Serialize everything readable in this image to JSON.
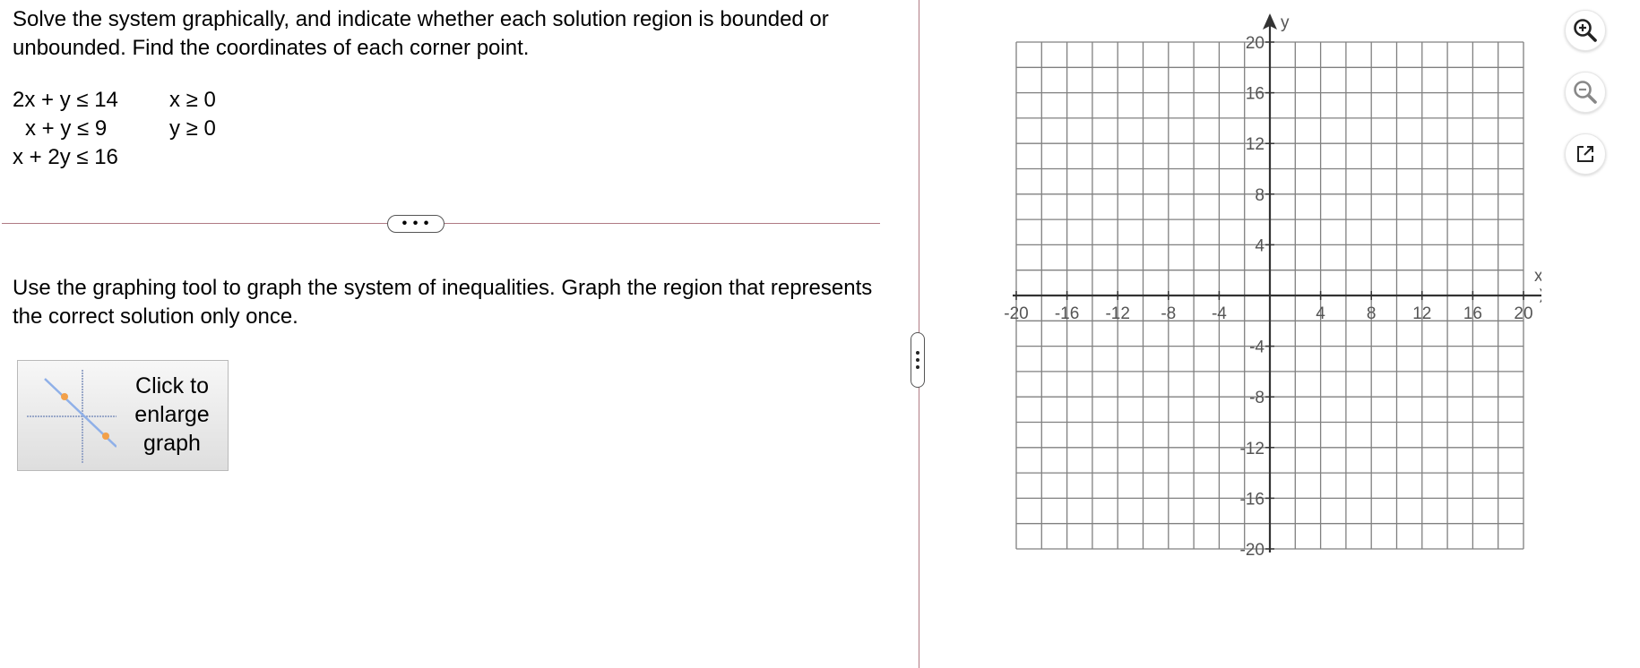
{
  "problem": {
    "prompt": "Solve the system graphically, and indicate whether each solution region is bounded or unbounded. Find the coordinates of each corner point.",
    "inequalities_left": [
      "2x + y ≤ 14",
      "x + y ≤ 9",
      "x + 2y ≤ 16"
    ],
    "inequalities_right": [
      "x ≥ 0",
      "y ≥ 0"
    ]
  },
  "divider": {
    "label": "• • •"
  },
  "instructions": "Use the graphing tool to graph the system of inequalities. Graph the region that represents the correct solution only once.",
  "enlarge_button": {
    "label": "Click to enlarge graph"
  },
  "graph": {
    "x_axis_label": "x",
    "y_axis_label": "y",
    "x_range": [
      -20,
      20
    ],
    "y_range": [
      -20,
      20
    ],
    "grid_step": 2,
    "x_tick_labels": [
      "-20",
      "-16",
      "-12",
      "-8",
      "-4",
      "4",
      "8",
      "12",
      "16",
      "20"
    ],
    "y_tick_labels": [
      "20",
      "16",
      "12",
      "8",
      "4",
      "-4",
      "-8",
      "-12",
      "-16",
      "-20"
    ],
    "x_tick_values": [
      -20,
      -16,
      -12,
      -8,
      -4,
      4,
      8,
      12,
      16,
      20
    ],
    "y_tick_values": [
      20,
      16,
      12,
      8,
      4,
      -4,
      -8,
      -12,
      -16,
      -20
    ]
  },
  "tools": {
    "zoom_in_icon": "zoom-in-icon",
    "zoom_out_icon": "zoom-out-icon",
    "popout_icon": "external-link-icon"
  }
}
